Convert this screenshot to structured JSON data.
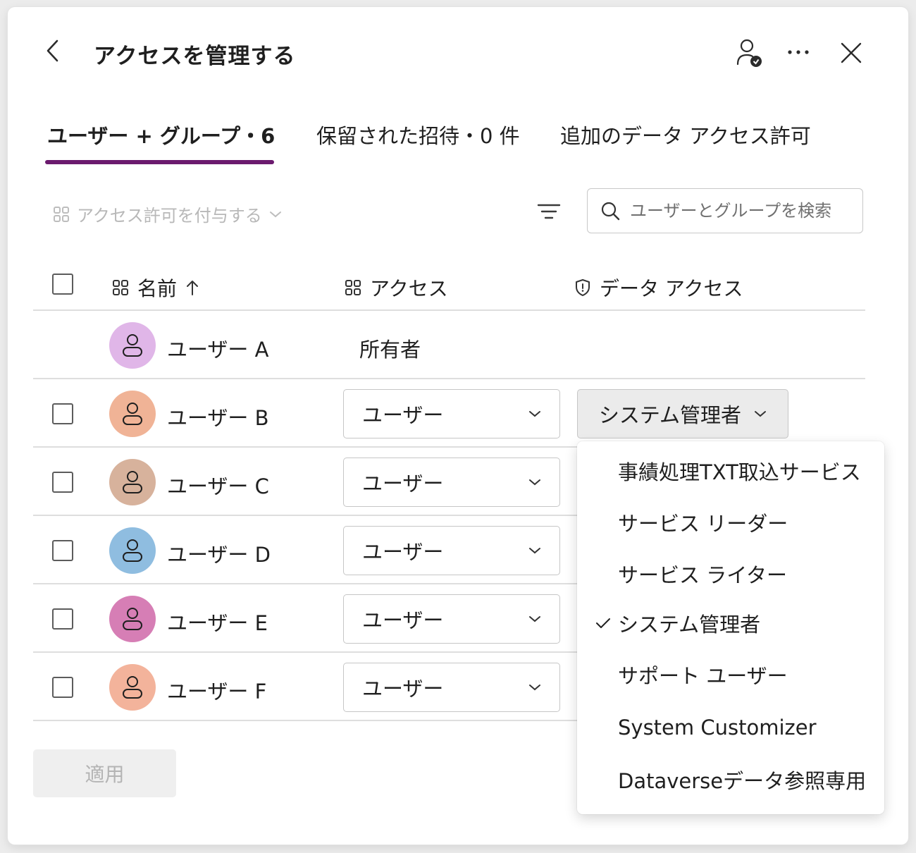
{
  "dialog": {
    "title": "アクセスを管理する"
  },
  "tabs": [
    {
      "label": "ユーザー + グループ・6",
      "active": true
    },
    {
      "label": "保留された招待・0 件",
      "active": false
    },
    {
      "label": "追加のデータ アクセス許可",
      "active": false
    }
  ],
  "toolbar": {
    "grant_label": "アクセス許可を付与する",
    "search_placeholder": "ユーザーとグループを検索"
  },
  "columns": {
    "name": "名前",
    "access": "アクセス",
    "data_access": "データ アクセス"
  },
  "rows": [
    {
      "name": "ユーザー A",
      "access": "所有者",
      "avatar_color": "#e0b6e8"
    },
    {
      "name": "ユーザー B",
      "access": "ユーザー",
      "data_access": "システム管理者",
      "avatar_color": "#f0b396"
    },
    {
      "name": "ユーザー C",
      "access": "ユーザー",
      "avatar_color": "#d7b29c"
    },
    {
      "name": "ユーザー D",
      "access": "ユーザー",
      "avatar_color": "#8fbde0"
    },
    {
      "name": "ユーザー E",
      "access": "ユーザー",
      "avatar_color": "#d67eb5"
    },
    {
      "name": "ユーザー F",
      "access": "ユーザー",
      "avatar_color": "#f3b39b"
    }
  ],
  "data_access_menu": {
    "items": [
      "事績処理TXT取込サービス",
      "サービス リーダー",
      "サービス ライター",
      "システム管理者",
      "サポート ユーザー",
      "System Customizer",
      "Dataverseデータ参照専用"
    ],
    "selected": "システム管理者"
  },
  "footer": {
    "apply_label": "適用"
  },
  "colors": {
    "accent": "#6b1a6e",
    "panel_bg": "#ffffff",
    "disabled_text": "#b4b4b4"
  }
}
